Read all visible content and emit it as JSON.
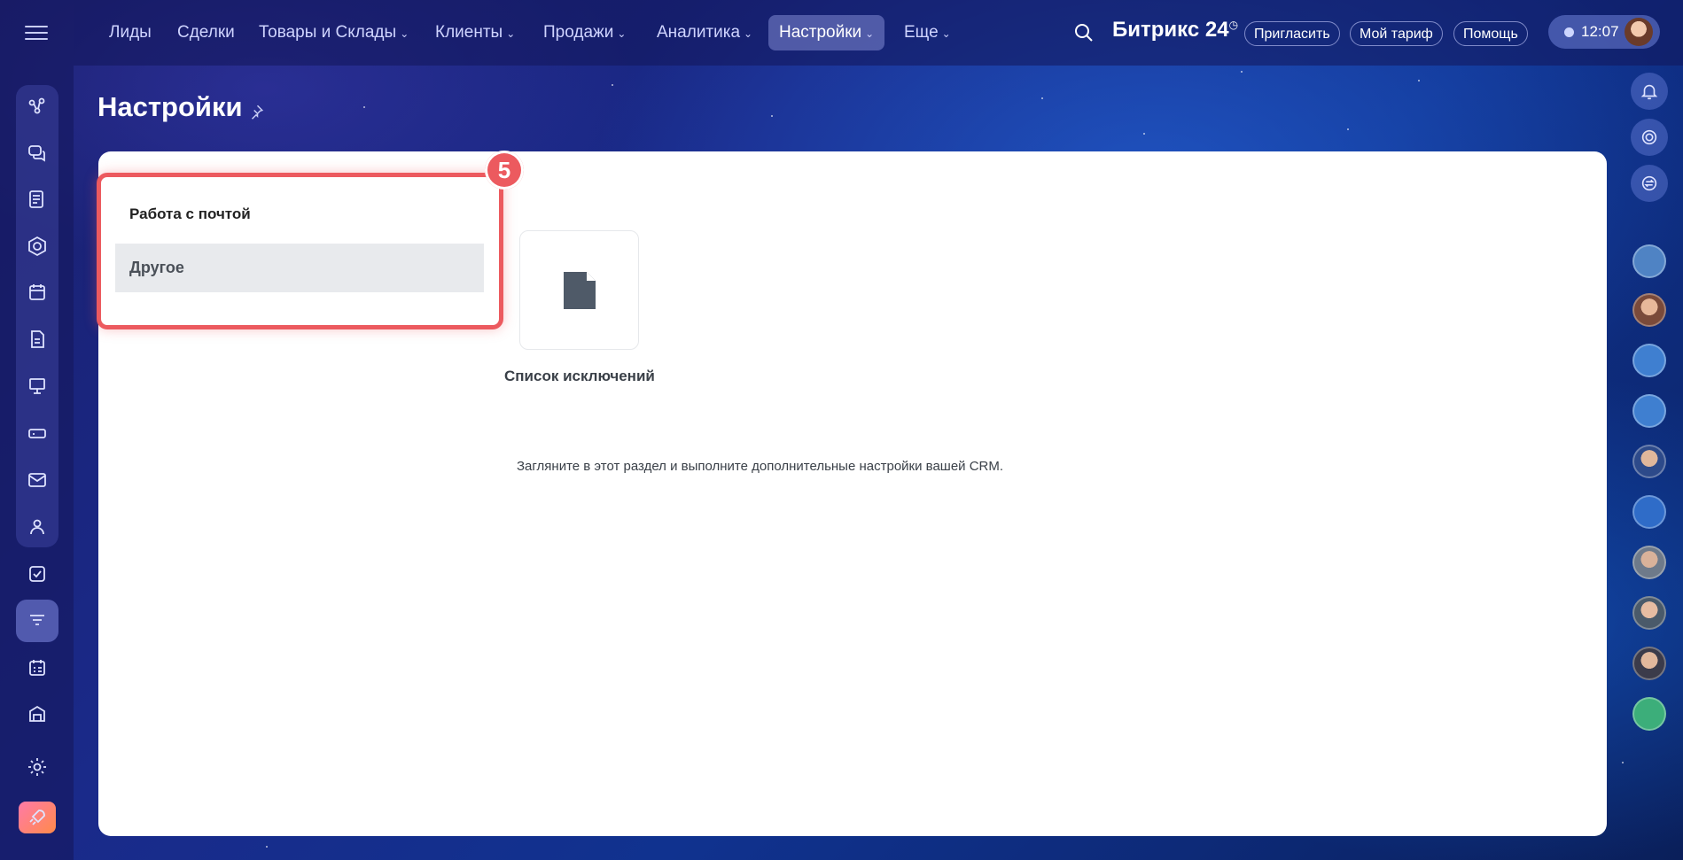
{
  "top_nav": {
    "items": [
      {
        "label": "Лиды",
        "chevron": false
      },
      {
        "label": "Сделки",
        "chevron": false
      },
      {
        "label": "Товары и Склады",
        "chevron": true
      },
      {
        "label": "Клиенты",
        "chevron": true
      },
      {
        "label": "Продажи",
        "chevron": true
      },
      {
        "label": "Аналитика",
        "chevron": true
      },
      {
        "label": "Настройки",
        "chevron": true,
        "active": true
      },
      {
        "label": "Еще",
        "chevron": true
      }
    ],
    "logo": "Битрикс 24",
    "invite_label": "Пригласить",
    "tariff_label": "Мой тариф",
    "help_label": "Помощь",
    "clock": "12:07"
  },
  "page": {
    "title": "Настройки"
  },
  "settings_menu": {
    "items": [
      {
        "label": "Работа с почтой",
        "selected": false
      },
      {
        "label": "Другое",
        "selected": true
      }
    ],
    "callout_number": "5"
  },
  "content": {
    "tile_label": "Список исключений",
    "tile_icon": "document-icon",
    "hint": "Загляните в этот раздел и выполните дополнительные настройки вашей CRM."
  },
  "colors": {
    "highlight": "#ec5a5f",
    "selected_bg": "#e8eaed"
  }
}
